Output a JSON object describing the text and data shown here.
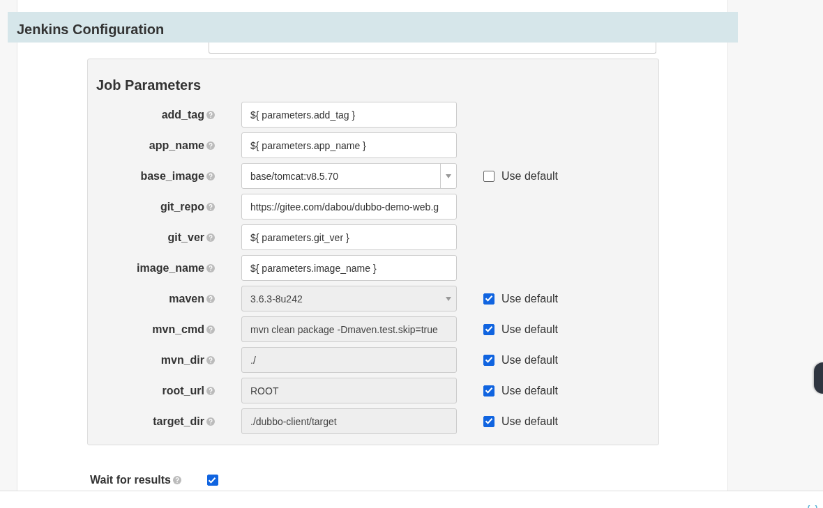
{
  "header": {
    "title": "Jenkins Configuration"
  },
  "job_parameters": {
    "title": "Job Parameters",
    "params": [
      {
        "name": "add_tag",
        "kind": "text",
        "value": "${ parameters.add_tag }",
        "disabled": false
      },
      {
        "name": "app_name",
        "kind": "text",
        "value": "${ parameters.app_name }",
        "disabled": false
      },
      {
        "name": "base_image",
        "kind": "select",
        "value": "base/tomcat:v8.5.70",
        "disabled": false,
        "use_default": {
          "label": "Use default",
          "checked": false
        }
      },
      {
        "name": "git_repo",
        "kind": "text",
        "value": "https://gitee.com/dabou/dubbo-demo-web.g",
        "disabled": false
      },
      {
        "name": "git_ver",
        "kind": "text",
        "value": "${ parameters.git_ver }",
        "disabled": false
      },
      {
        "name": "image_name",
        "kind": "text",
        "value": "${ parameters.image_name }",
        "disabled": false
      },
      {
        "name": "maven",
        "kind": "select",
        "value": "3.6.3-8u242",
        "disabled": true,
        "use_default": {
          "label": "Use default",
          "checked": true
        }
      },
      {
        "name": "mvn_cmd",
        "kind": "text",
        "value": "mvn clean package -Dmaven.test.skip=true",
        "disabled": true,
        "use_default": {
          "label": "Use default",
          "checked": true
        }
      },
      {
        "name": "mvn_dir",
        "kind": "text",
        "value": "./",
        "disabled": true,
        "use_default": {
          "label": "Use default",
          "checked": true
        }
      },
      {
        "name": "root_url",
        "kind": "text",
        "value": "ROOT",
        "disabled": true,
        "use_default": {
          "label": "Use default",
          "checked": true
        }
      },
      {
        "name": "target_dir",
        "kind": "text",
        "value": "./dubbo-client/target",
        "disabled": true,
        "use_default": {
          "label": "Use default",
          "checked": true
        }
      }
    ]
  },
  "wait_for_results": {
    "label": "Wait for results",
    "checked": true
  }
}
